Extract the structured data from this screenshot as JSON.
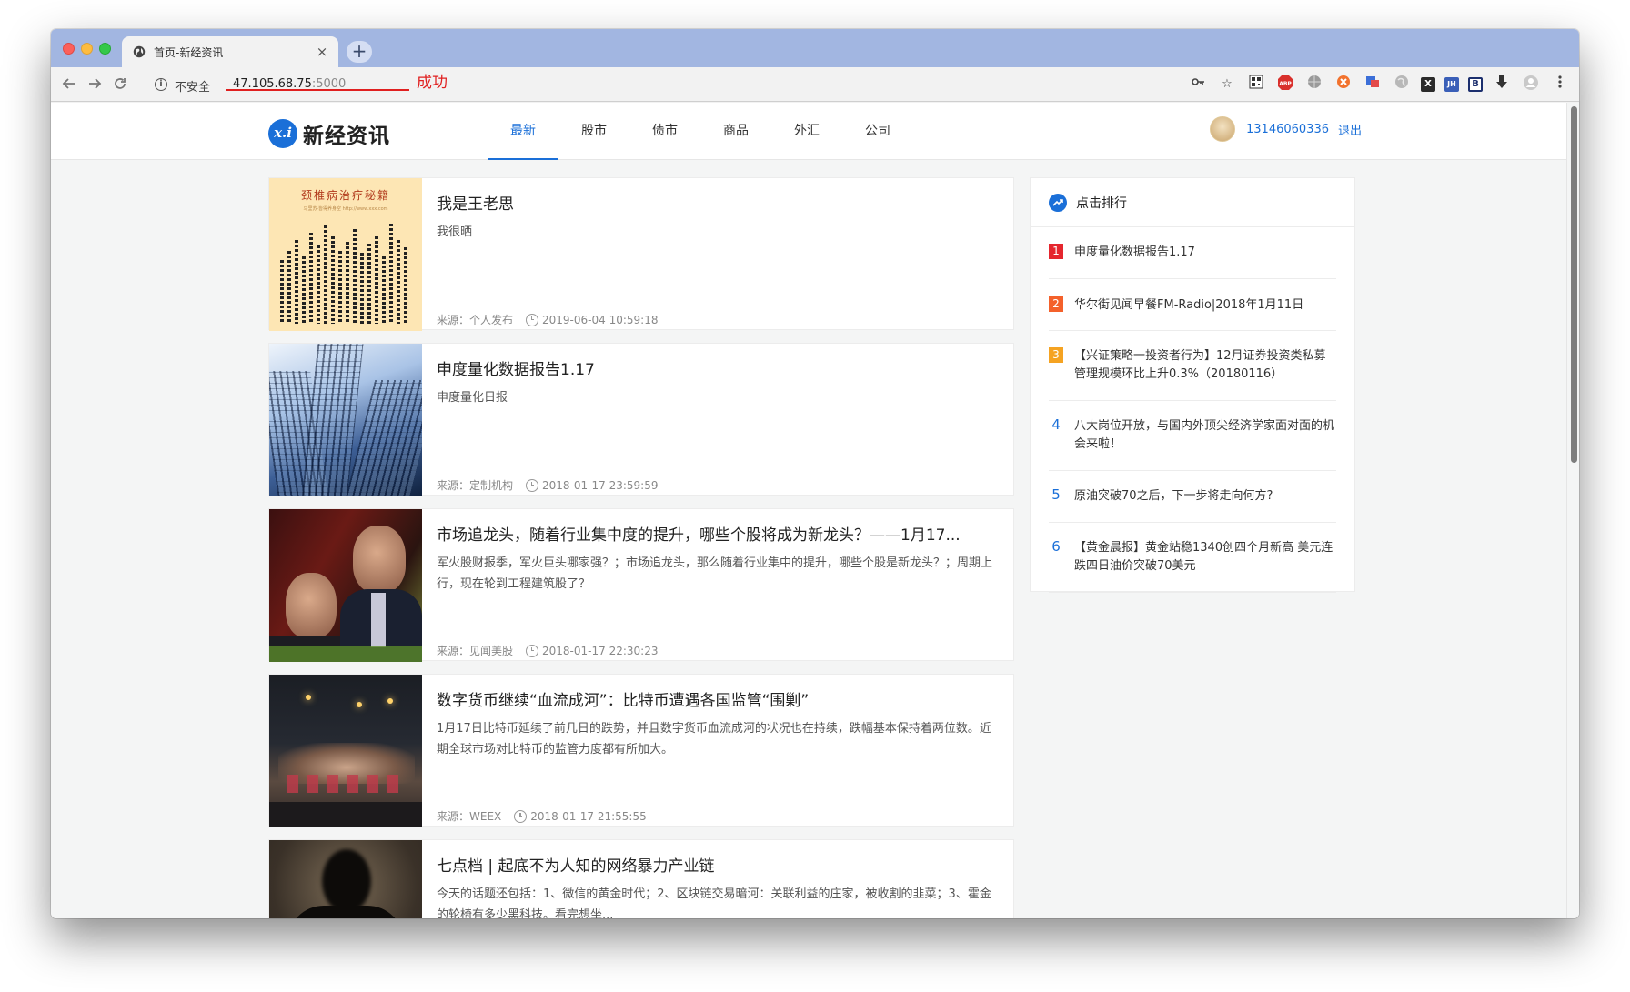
{
  "browser": {
    "tab_title": "首页-新经资讯",
    "tab_close": "×",
    "new_tab": "+",
    "insecure_label": "不安全",
    "url_host": "47.105.68.75",
    "url_port": ":5000",
    "annotation_label": "成功",
    "nav_icons": [
      "back-arrow-icon",
      "forward-arrow-icon",
      "reload-icon"
    ],
    "extensions": [
      "key-icon",
      "star-icon",
      "qr-icon",
      "adblock-icon",
      "globe-icon",
      "orange-icon",
      "translate-icon",
      "earth-icon",
      "x-icon",
      "jh-icon",
      "b-icon",
      "download-icon",
      "profile-icon",
      "menu-icon"
    ],
    "extension_labels": {
      "adblock": "ABP",
      "x": "X",
      "jh": "JH",
      "b": "B"
    }
  },
  "site": {
    "logo_mark": "x.i",
    "logo_text": "新经资讯",
    "nav": [
      {
        "label": "最新",
        "active": true
      },
      {
        "label": "股市",
        "active": false
      },
      {
        "label": "债市",
        "active": false
      },
      {
        "label": "商品",
        "active": false
      },
      {
        "label": "外汇",
        "active": false
      },
      {
        "label": "公司",
        "active": false
      }
    ],
    "user_phone": "13146060336",
    "logout_label": "退出"
  },
  "thumb1": {
    "title": "颈椎病治疗秘籍",
    "sub": "马里苏·皆得养身空 http://www.xxx.com"
  },
  "articles": [
    {
      "title": "我是王老思",
      "summary": "我很晒",
      "source": "来源：个人发布",
      "time": "2019-06-04 10:59:18"
    },
    {
      "title": "申度量化数据报告1.17",
      "summary": "申度量化日报",
      "source": "来源：定制机构",
      "time": "2018-01-17 23:59:59"
    },
    {
      "title": "市场追龙头，随着行业集中度的提升，哪些个股将成为新龙头？——1月17...",
      "summary": "军火股财报季，军火巨头哪家强？；市场追龙头，那么随着行业集中的提升，哪些个股是新龙头？；周期上行，现在轮到工程建筑股了？",
      "source": "来源：见闻美股",
      "time": "2018-01-17 22:30:23"
    },
    {
      "title": "数字货币继续“血流成河”：比特币遭遇各国监管“围剿”",
      "summary": "1月17日比特币延续了前几日的跌势，并且数字货币血流成河的状况也在持续，跌幅基本保持着两位数。近期全球市场对比特币的监管力度都有所加大。",
      "source": "来源：WEEX",
      "time": "2018-01-17 21:55:55"
    },
    {
      "title": "七点档 | 起底不为人知的网络暴力产业链",
      "summary": "今天的话题还包括：1、微信的黄金时代；2、区块链交易暗河：关联利益的庄家，被收割的韭菜；3、霍金的轮椅有多少黑科技。看完想坐...",
      "source": "",
      "time": ""
    }
  ],
  "ranking": {
    "title": "点击排行",
    "items": [
      {
        "num": "1",
        "text": "申度量化数据报告1.17",
        "color": "#e5262e"
      },
      {
        "num": "2",
        "text": "华尔街见闻早餐FM-Radio|2018年1月11日",
        "color": "#f4612b"
      },
      {
        "num": "3",
        "text": "【兴证策略一投资者行为】12月证券投资类私募管理规模环比上升0.3%（20180116）",
        "color": "#f5a322"
      },
      {
        "num": "4",
        "text": "八大岗位开放，与国内外顶尖经济学家面对面的机会来啦！",
        "color": "#1a6fd8"
      },
      {
        "num": "5",
        "text": "原油突破70之后，下一步将走向何方?",
        "color": "#1a6fd8"
      },
      {
        "num": "6",
        "text": "【黄金晨报】黄金站稳1340创四个月新高 美元连跌四日油价突破70美元",
        "color": "#1a6fd8"
      }
    ]
  }
}
